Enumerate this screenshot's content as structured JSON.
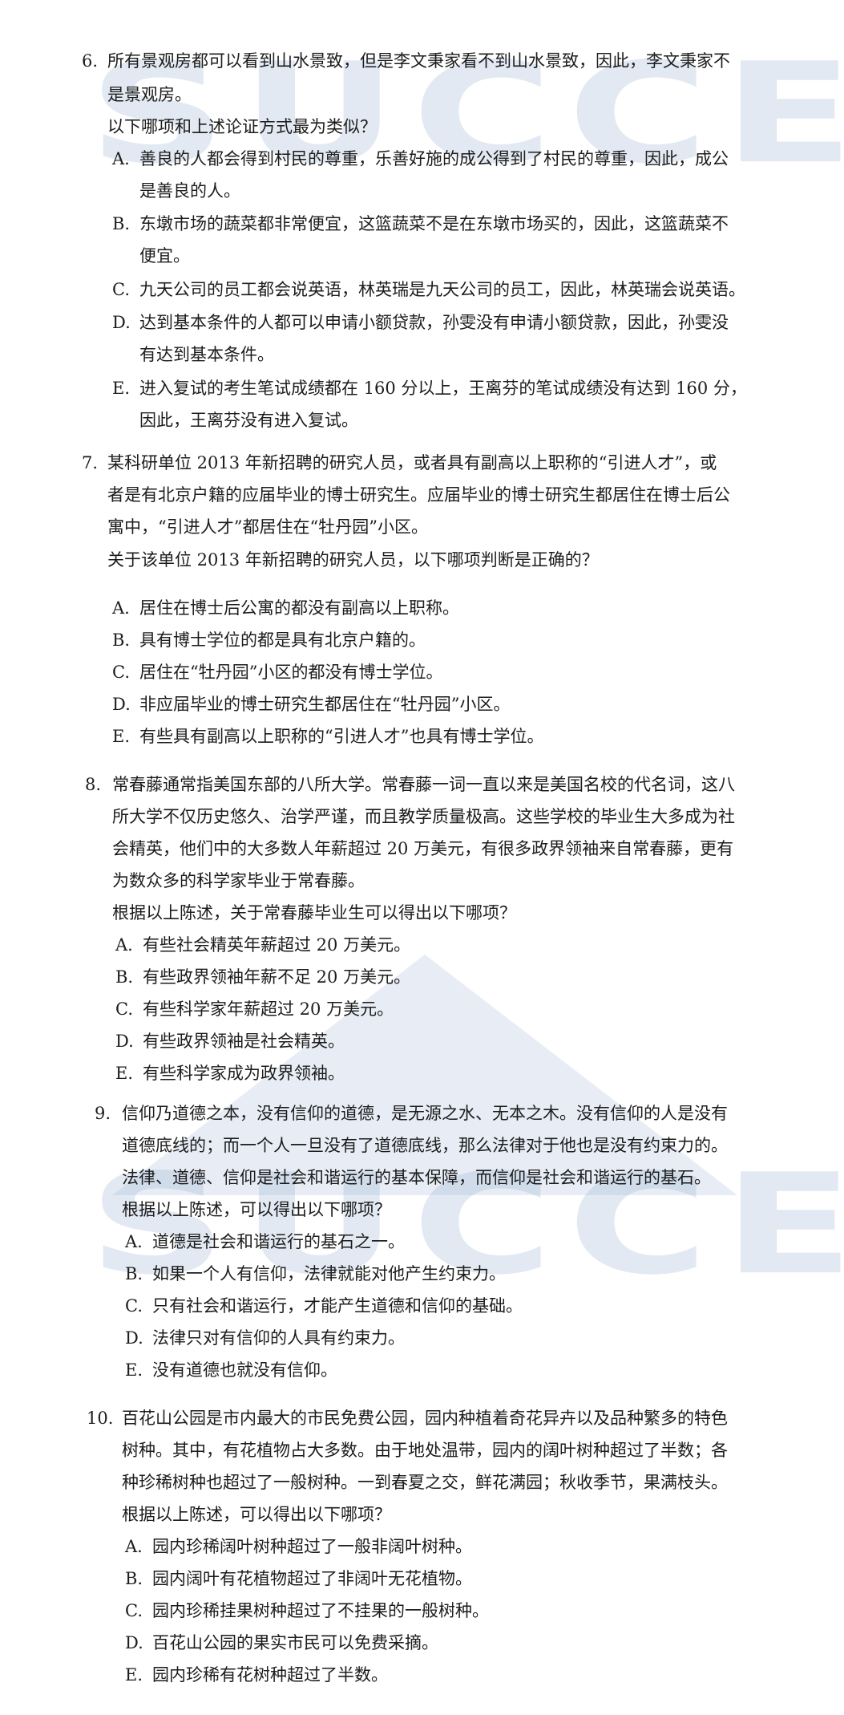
{
  "watermark": {
    "text": "SUCCESS"
  },
  "questions": [
    {
      "number": "6.",
      "stem": [
        "所有景观房都可以看到山水景致，但是李文秉家看不到山水景致，因此，李文秉家不",
        "是景观房。"
      ],
      "prompt": "以下哪项和上述论证方式最为类似？",
      "options": [
        {
          "letter": "A.",
          "lines": [
            "善良的人都会得到村民的尊重，乐善好施的成公得到了村民的尊重，因此，成公",
            "是善良的人。"
          ]
        },
        {
          "letter": "B.",
          "lines": [
            "东墩市场的蔬菜都非常便宜，这篮蔬菜不是在东墩市场买的，因此，这篮蔬菜不",
            "便宜。"
          ]
        },
        {
          "letter": "C.",
          "lines": [
            "九天公司的员工都会说英语，林英瑞是九天公司的员工，因此，林英瑞会说英语。"
          ]
        },
        {
          "letter": "D.",
          "lines": [
            "达到基本条件的人都可以申请小额贷款，孙雯没有申请小额贷款，因此，孙雯没",
            "有达到基本条件。"
          ]
        },
        {
          "letter": "E.",
          "lines": [
            "进入复试的考生笔试成绩都在 160 分以上，王离芬的笔试成绩没有达到 160 分，",
            "因此，王离芬没有进入复试。"
          ]
        }
      ]
    },
    {
      "number": "7.",
      "stem": [
        "某科研单位 2013 年新招聘的研究人员，或者具有副高以上职称的“引进人才”，或",
        "者是有北京户籍的应届毕业的博士研究生。应届毕业的博士研究生都居住在博士后公",
        "寓中，“引进人才”都居住在“牡丹园”小区。"
      ],
      "prompt": "关于该单位 2013 年新招聘的研究人员，以下哪项判断是正确的？",
      "options": [
        {
          "letter": "A.",
          "lines": [
            "居住在博士后公寓的都没有副高以上职称。"
          ]
        },
        {
          "letter": "B.",
          "lines": [
            "具有博士学位的都是具有北京户籍的。"
          ]
        },
        {
          "letter": "C.",
          "lines": [
            "居住在“牡丹园”小区的都没有博士学位。"
          ]
        },
        {
          "letter": "D.",
          "lines": [
            "非应届毕业的博士研究生都居住在“牡丹园”小区。"
          ]
        },
        {
          "letter": "E.",
          "lines": [
            "有些具有副高以上职称的“引进人才”也具有博士学位。"
          ]
        }
      ]
    },
    {
      "number": "8.",
      "stem": [
        "常春藤通常指美国东部的八所大学。常春藤一词一直以来是美国名校的代名词，这八",
        "所大学不仅历史悠久、治学严谨，而且教学质量极高。这些学校的毕业生大多成为社",
        "会精英，他们中的大多数人年薪超过 20 万美元，有很多政界领袖来自常春藤，更有",
        "为数众多的科学家毕业于常春藤。"
      ],
      "prompt": "根据以上陈述，关于常春藤毕业生可以得出以下哪项？",
      "options": [
        {
          "letter": "A.",
          "lines": [
            "有些社会精英年薪超过 20 万美元。"
          ]
        },
        {
          "letter": "B.",
          "lines": [
            "有些政界领袖年薪不足 20 万美元。"
          ]
        },
        {
          "letter": "C.",
          "lines": [
            "有些科学家年薪超过 20 万美元。"
          ]
        },
        {
          "letter": "D.",
          "lines": [
            "有些政界领袖是社会精英。"
          ]
        },
        {
          "letter": "E.",
          "lines": [
            "有些科学家成为政界领袖。"
          ]
        }
      ]
    },
    {
      "number": "9.",
      "stem": [
        "信仰乃道德之本，没有信仰的道德，是无源之水、无本之木。没有信仰的人是没有",
        "道德底线的；而一个人一旦没有了道德底线，那么法律对于他也是没有约束力的。",
        "法律、道德、信仰是社会和谐运行的基本保障，而信仰是社会和谐运行的基石。"
      ],
      "prompt": "根据以上陈述，可以得出以下哪项？",
      "options": [
        {
          "letter": "A.",
          "lines": [
            "道德是社会和谐运行的基石之一。"
          ]
        },
        {
          "letter": "B.",
          "lines": [
            "如果一个人有信仰，法律就能对他产生约束力。"
          ]
        },
        {
          "letter": "C.",
          "lines": [
            "只有社会和谐运行，才能产生道德和信仰的基础。"
          ]
        },
        {
          "letter": "D.",
          "lines": [
            "法律只对有信仰的人具有约束力。"
          ]
        },
        {
          "letter": "E.",
          "lines": [
            "没有道德也就没有信仰。"
          ]
        }
      ]
    },
    {
      "number": "10.",
      "stem": [
        "百花山公园是市内最大的市民免费公园，园内种植着奇花异卉以及品种繁多的特色",
        "树种。其中，有花植物占大多数。由于地处温带，园内的阔叶树种超过了半数；各",
        "种珍稀树种也超过了一般树种。一到春夏之交，鲜花满园；秋收季节，果满枝头。"
      ],
      "prompt": "根据以上陈述，可以得出以下哪项？",
      "options": [
        {
          "letter": "A.",
          "lines": [
            "园内珍稀阔叶树种超过了一般非阔叶树种。"
          ]
        },
        {
          "letter": "B.",
          "lines": [
            "园内阔叶有花植物超过了非阔叶无花植物。"
          ]
        },
        {
          "letter": "C.",
          "lines": [
            "园内珍稀挂果树种超过了不挂果的一般树种。"
          ]
        },
        {
          "letter": "D.",
          "lines": [
            "百花山公园的果实市民可以免费采摘。"
          ]
        },
        {
          "letter": "E.",
          "lines": [
            "园内珍稀有花树种超过了半数。"
          ]
        }
      ]
    }
  ]
}
